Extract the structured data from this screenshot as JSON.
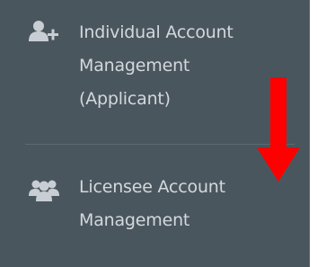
{
  "menu": {
    "items": [
      {
        "icon": "add-user-icon",
        "label_lines": [
          "Individual Account",
          "Management",
          "(Applicant)"
        ]
      },
      {
        "icon": "users-group-icon",
        "label_lines": [
          "Licensee Account",
          "Management"
        ]
      }
    ]
  },
  "annotation": {
    "icon": "red-down-arrow-icon",
    "color": "#ff0000"
  },
  "colors": {
    "sidebar_background": "#4a565e",
    "text": "#d3d8dc",
    "icon": "#c8ced3",
    "divider": "#5d6a72"
  }
}
